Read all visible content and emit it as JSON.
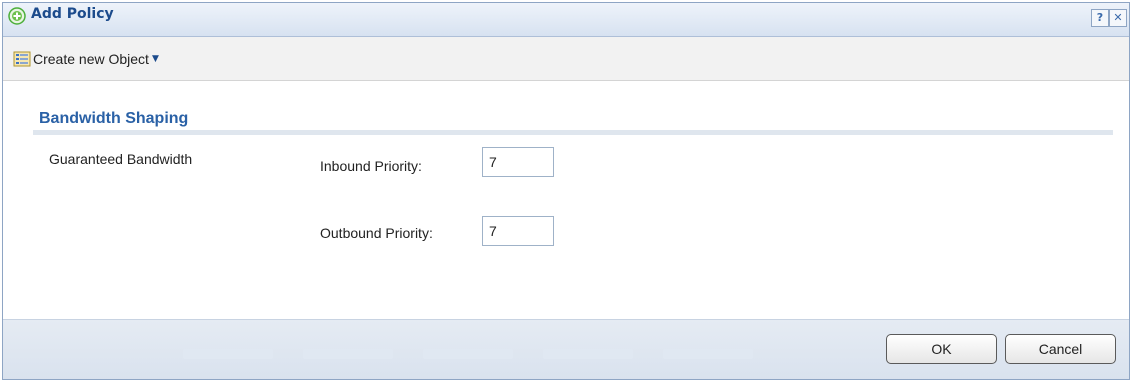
{
  "dialog": {
    "title": "Add Policy",
    "help_label": "?",
    "close_label": "✕"
  },
  "toolbar": {
    "create_label": "Create new Object",
    "caret": "▼"
  },
  "section": {
    "title": "Bandwidth Shaping",
    "row_label": "Guaranteed Bandwidth",
    "inbound_label": "Inbound Priority:",
    "inbound_value": "7",
    "outbound_label": "Outbound Priority:",
    "outbound_value": "7"
  },
  "footer": {
    "ok_label": "OK",
    "cancel_label": "Cancel"
  },
  "colors": {
    "title_text": "#1c4b8c",
    "section_title": "#2a61a6",
    "add_icon": "#4caf3a"
  },
  "icons": {
    "title": "add-circle-icon",
    "toolbar": "object-list-icon",
    "help": "help-icon",
    "close": "close-icon"
  }
}
